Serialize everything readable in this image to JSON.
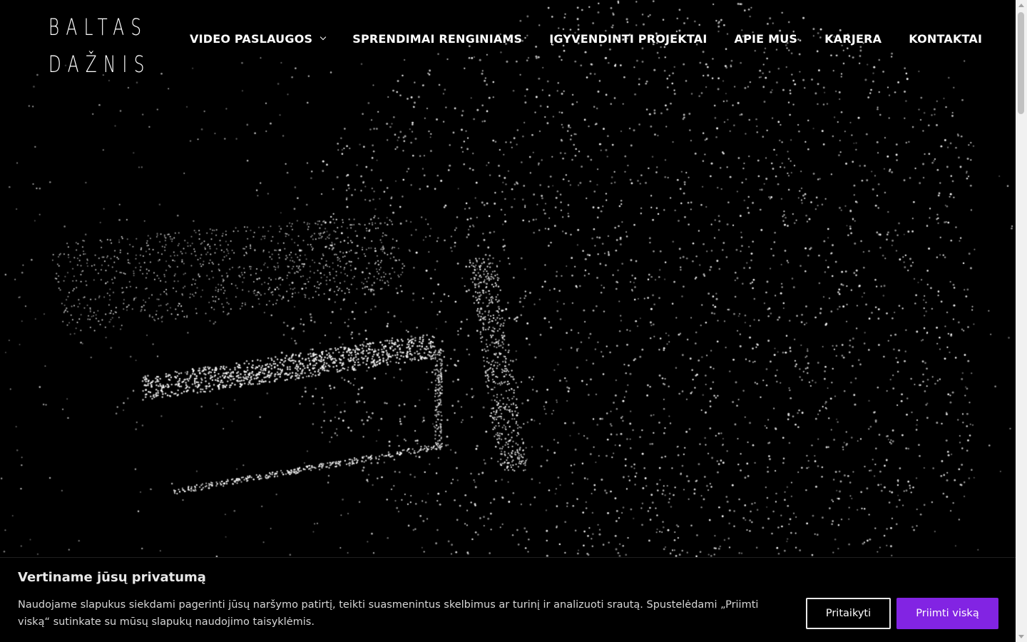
{
  "logo": {
    "line1": "BALTAS",
    "line2": "DAŽNIS"
  },
  "nav": {
    "items": [
      {
        "label": "VIDEO PASLAUGOS",
        "has_dropdown": true
      },
      {
        "label": "SPRENDIMAI RENGINIAMS"
      },
      {
        "label": "ĮGYVENDINTI PROJEKTAI"
      },
      {
        "label": "APIE MUS"
      },
      {
        "label": "KARJERA"
      },
      {
        "label": "KONTAKTAI"
      }
    ]
  },
  "cookie_banner": {
    "title": "Vertiname jūsų privatumą",
    "text": "Naudojame slapukus siekdami pagerinti jūsų naršymo patirtį, teikti suasmenintus skelbimus ar turinį ir analizuoti srautą. Spustelėdami „Priimti viską“ sutinkate su mūsų slapukų naudojimo taisyklėmis.",
    "customize_label": "Pritaikyti",
    "accept_label": "Priimti viską"
  },
  "colors": {
    "background": "#000000",
    "text": "#ffffff",
    "accent": "#8224e3",
    "particles": "#ffffff"
  },
  "icons": {
    "dropdown": "chevron-down-icon"
  }
}
